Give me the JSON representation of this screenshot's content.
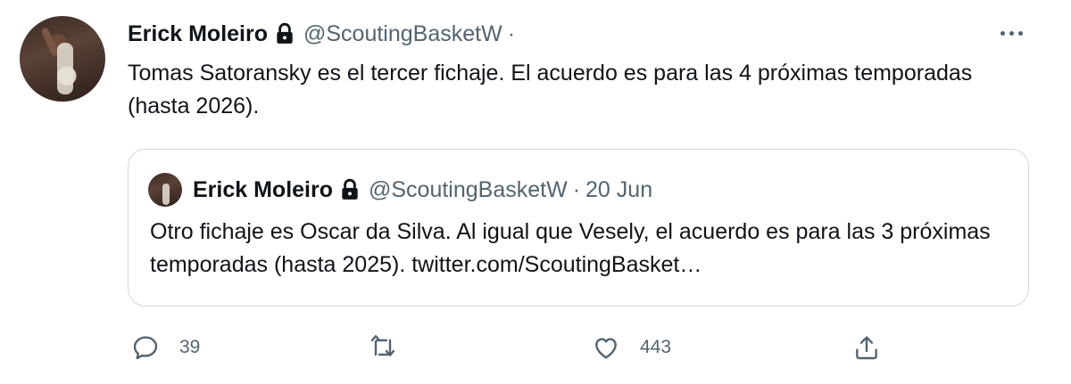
{
  "tweet": {
    "author_name": "Erick Moleiro",
    "handle": "@ScoutingBasketW",
    "separator": "·",
    "text": "Tomas Satoransky es el tercer fichaje. El acuerdo es para las 4 próximas temporadas (hasta 2026)."
  },
  "quoted": {
    "author_name": "Erick Moleiro",
    "handle": "@ScoutingBasketW",
    "separator": "·",
    "date": "20 Jun",
    "text": "Otro fichaje es Oscar da Silva. Al igual que Vesely, el acuerdo es para las 3 próximas temporadas (hasta 2025). twitter.com/ScoutingBasket…"
  },
  "actions": {
    "reply_count": "39",
    "retweet_count": "",
    "like_count": "443"
  },
  "icons": {
    "lock": "lock-icon",
    "more": "more-icon",
    "reply": "reply-icon",
    "retweet": "retweet-icon",
    "like": "like-icon",
    "share": "share-icon"
  },
  "colors": {
    "text": "#0f1419",
    "muted": "#536471",
    "border": "#cfd9de"
  }
}
